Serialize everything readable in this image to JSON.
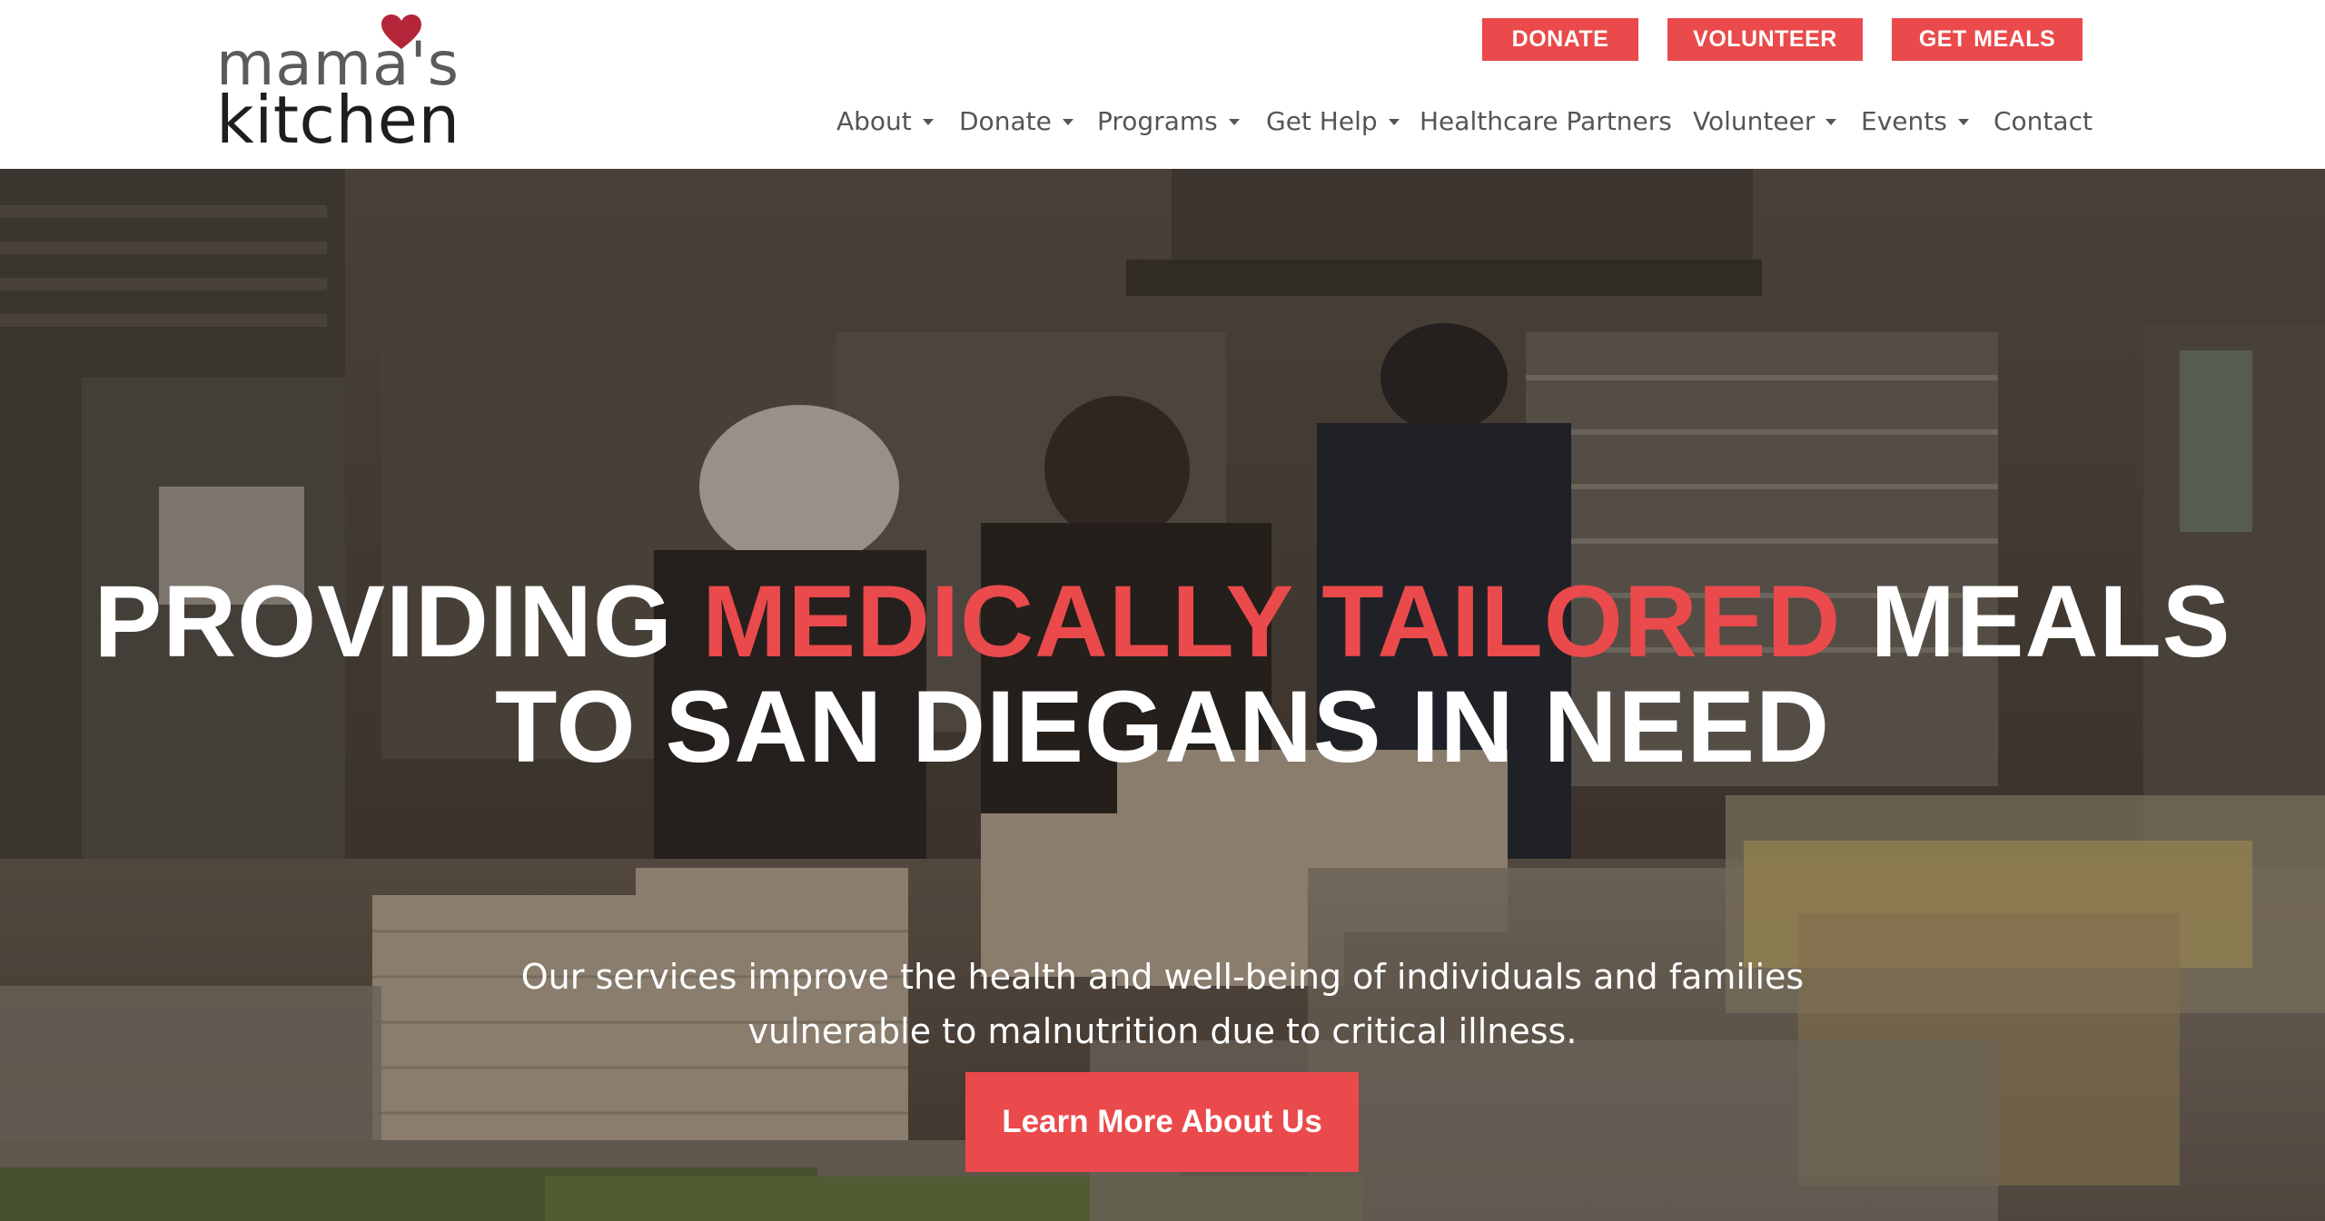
{
  "brand": {
    "logo_top": "mama's",
    "logo_bottom": "kitchen",
    "heart_color": "#b5253a"
  },
  "top_buttons": {
    "donate": "DONATE",
    "volunteer": "VOLUNTEER",
    "get_meals": "GET MEALS"
  },
  "nav": {
    "about": "About",
    "donate": "Donate",
    "programs": "Programs",
    "get_help": "Get Help",
    "healthcare_partners": "Healthcare Partners",
    "volunteer": "Volunteer",
    "events": "Events",
    "contact": "Contact"
  },
  "hero": {
    "headline_part1": "PROVIDING ",
    "headline_accent": "MEDICALLY TAILORED",
    "headline_part2": " MEALS",
    "headline_line2": "TO SAN DIEGANS IN NEED",
    "subtext_line1": "Our services improve the health and well-being of individuals and families",
    "subtext_line2": "vulnerable to malnutrition due to critical illness.",
    "cta_label": "Learn More About Us"
  },
  "colors": {
    "accent": "#ea4a4b",
    "nav_text": "#555555",
    "header_bg": "#ffffff"
  }
}
